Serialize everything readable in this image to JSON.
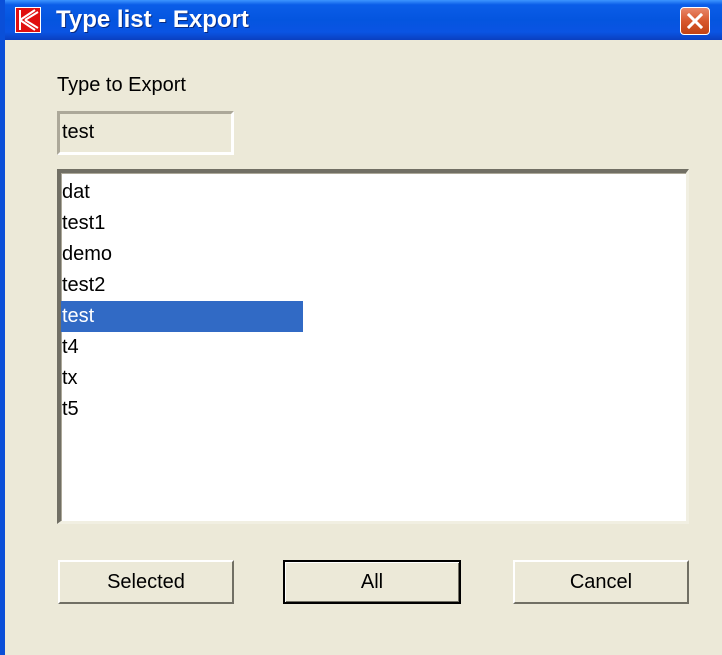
{
  "window": {
    "title": "Type list - Export",
    "icon": "app-k-logo-icon",
    "close_icon": "close-icon"
  },
  "form": {
    "type_label": "Type to Export",
    "type_value": "test"
  },
  "list": {
    "items": [
      "dat",
      "test1",
      "demo",
      "test2",
      "test",
      "t4",
      "tx",
      "t5"
    ],
    "selected_index": 4
  },
  "buttons": {
    "selected": "Selected",
    "all": "All",
    "cancel": "Cancel"
  },
  "colors": {
    "titlebar": "#0455DF",
    "dialog_bg": "#ECE9D8",
    "selection": "#316AC5",
    "close_button": "#D8582D"
  }
}
